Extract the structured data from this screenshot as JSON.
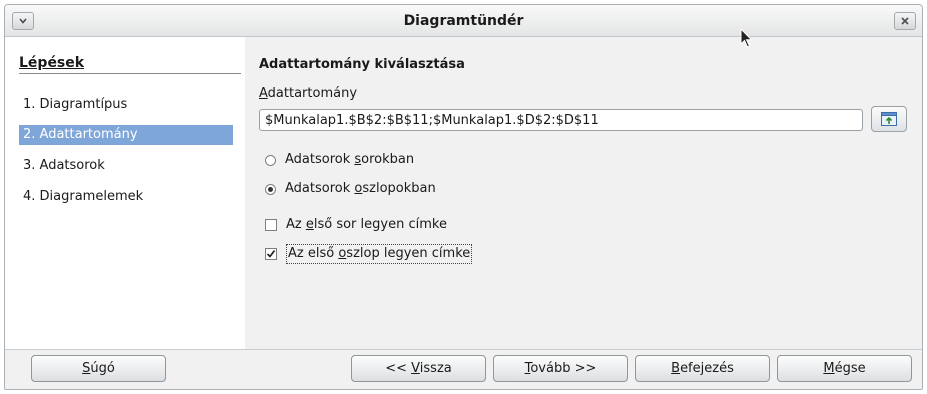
{
  "window": {
    "title": "Diagramtündér"
  },
  "sidebar": {
    "title": "Lépések",
    "steps": [
      {
        "label": "1. Diagramtípus",
        "selected": false
      },
      {
        "label": "2. Adattartomány",
        "selected": true
      },
      {
        "label": "3. Adatsorok",
        "selected": false
      },
      {
        "label": "4. Diagramelemek",
        "selected": false
      }
    ]
  },
  "main": {
    "heading": "Adattartomány kiválasztása",
    "range_label": {
      "mnemonic": "A",
      "rest": "dattartomány"
    },
    "range_value": "$Munkalap1.$B$2:$B$11;$Munkalap1.$D$2:$D$11",
    "radio_rows": {
      "pre": "Adatsorok ",
      "mnemonic": "s",
      "rest": "orokban",
      "checked": false
    },
    "radio_cols": {
      "pre": "Adatsorok ",
      "mnemonic": "o",
      "rest": "szlopokban",
      "checked": true
    },
    "check_first_row": {
      "pre": "Az ",
      "mnemonic": "e",
      "rest": "lső sor legyen címke",
      "checked": false
    },
    "check_first_col": {
      "pre": "Az első ",
      "mnemonic": "o",
      "rest": "szlop legyen címke",
      "checked": true
    }
  },
  "buttons": {
    "help": {
      "mnemonic": "S",
      "rest": "úgó"
    },
    "back": {
      "pre": "<< ",
      "mnemonic": "V",
      "rest": "issza"
    },
    "next": {
      "mnemonic": "T",
      "rest": "ovább >>"
    },
    "finish": {
      "mnemonic": "B",
      "rest": "efejezés"
    },
    "cancel": {
      "mnemonic": "M",
      "rest": "égse"
    }
  },
  "icons": {
    "menu": "chevron-down-icon",
    "close": "close-icon",
    "shrink": "shrink-range-icon",
    "cursor": "mouse-pointer-icon"
  },
  "colors": {
    "selected_step": "#7fa6d9"
  }
}
